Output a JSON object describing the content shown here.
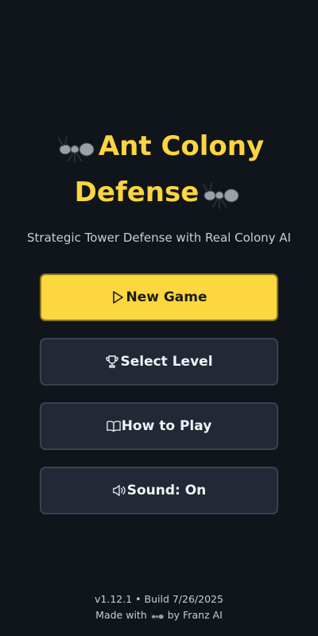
{
  "title": {
    "line1": "Ant Colony",
    "line2": "Defense",
    "icon": "ant-icon"
  },
  "subtitle": "Strategic Tower Defense with Real Colony AI",
  "menu": {
    "new_game": {
      "label": "New Game",
      "icon": "play-icon"
    },
    "select_level": {
      "label": "Select Level",
      "icon": "trophy-icon"
    },
    "how_to_play": {
      "label": "How to Play",
      "icon": "book-icon"
    },
    "sound": {
      "label": "Sound: On",
      "icon": "speaker-icon"
    }
  },
  "footer": {
    "version": "v1.12.1 • Build 7/26/2025",
    "made_with_prefix": "Made with",
    "made_with_suffix": "by Franz AI"
  },
  "colors": {
    "background": "#10151c",
    "accent": "#fcd53f",
    "button": "#232836",
    "button_border": "#3a4150"
  }
}
